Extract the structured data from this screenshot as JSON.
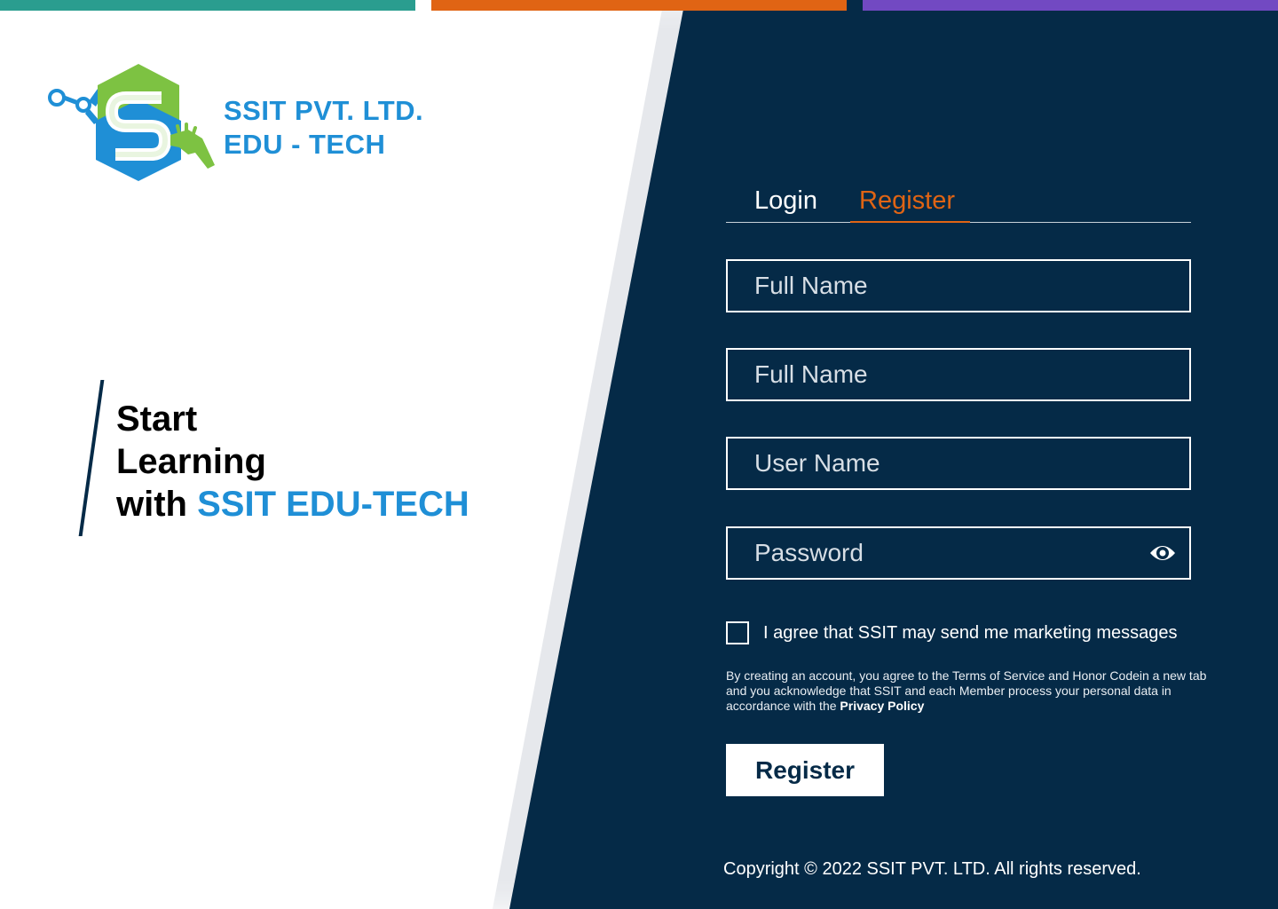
{
  "brand": {
    "line1": "SSIT PVT. LTD.",
    "line2": "EDU - TECH",
    "logo_icon": "ssit-hexagon-logo-icon",
    "colors": {
      "blue": "#1f8fd6",
      "green": "#7dc242",
      "dark": "#052a47",
      "orange": "#e06414"
    }
  },
  "tagline": {
    "line1": "Start",
    "line2": "Learning",
    "line3_prefix": "with",
    "line3_highlight": "SSIT EDU-TECH"
  },
  "tabs": {
    "login": "Login",
    "register": "Register",
    "active": "register"
  },
  "form": {
    "field1_placeholder": "Full Name",
    "field2_placeholder": "Full Name",
    "username_placeholder": "User Name",
    "password_placeholder": "Password",
    "password_toggle_icon": "eye-icon",
    "marketing_label": "I agree that SSIT may send me marketing messages",
    "marketing_checked": false,
    "terms_text": "By creating an account, you agree to the Terms of Service and Honor Codein a new tab and you acknowledge that SSIT and each Member process your personal data in accordance with the",
    "privacy_link": "Privacy Policy",
    "submit_label": "Register"
  },
  "footer": {
    "copyright": "Copyright © 2022 SSIT PVT. LTD. All rights reserved."
  },
  "strip_colors": [
    "#2a9d8f",
    "#e06414",
    "#7249c2"
  ]
}
